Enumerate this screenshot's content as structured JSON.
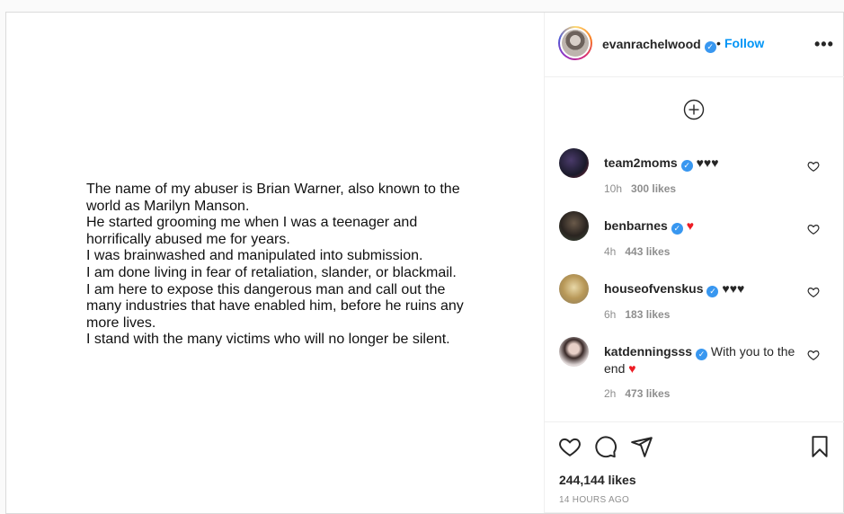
{
  "post": {
    "lines": [
      "The name of my abuser is Brian Warner, also known to the world as Marilyn Manson.",
      "He started grooming me when I was a teenager and horrifically abused me for years.",
      "I was brainwashed and manipulated into submission.",
      "I am done living in fear of retaliation, slander, or blackmail.",
      "I am here to expose this dangerous man and call out the many industries that have enabled him, before he ruins any more lives.",
      "I stand with the many victims who will no longer be silent."
    ]
  },
  "header": {
    "username": "evanrachelwood",
    "dot": "•",
    "follow_label": "Follow",
    "more_label": "•••"
  },
  "comments": [
    {
      "user": "team2moms",
      "text": "",
      "hearts": [
        "black",
        "black",
        "black"
      ],
      "time": "10h",
      "likes": "300 likes"
    },
    {
      "user": "benbarnes",
      "text": "",
      "hearts": [
        "red"
      ],
      "time": "4h",
      "likes": "443 likes"
    },
    {
      "user": "houseofvenskus",
      "text": "",
      "hearts": [
        "black",
        "black",
        "black"
      ],
      "time": "6h",
      "likes": "183 likes"
    },
    {
      "user": "katdenningsss",
      "text": "With you to the end",
      "hearts": [
        "red"
      ],
      "time": "2h",
      "likes": "473 likes"
    }
  ],
  "footer": {
    "likes": "244,144 likes",
    "timestamp": "14 HOURS AGO"
  },
  "colors": {
    "follow": "#0095f6",
    "verified": "#3897f0",
    "heart_red": "#ed1c24"
  }
}
